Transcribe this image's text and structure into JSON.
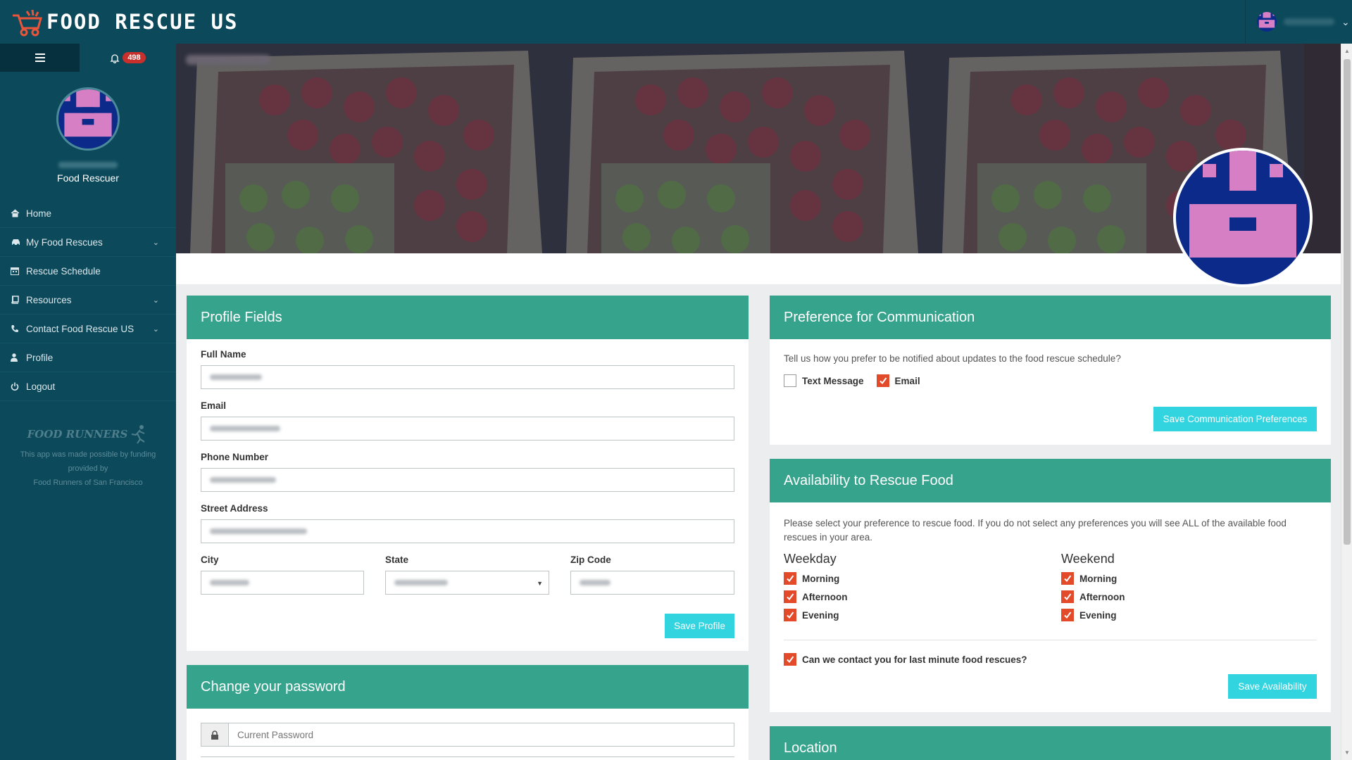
{
  "app": {
    "brand": "FOOD RESCUE US"
  },
  "sidebar": {
    "notification_count": "498",
    "role": "Food Rescuer",
    "items": [
      {
        "label": "Home",
        "icon": "home-icon"
      },
      {
        "label": "My Food Rescues",
        "icon": "car-icon"
      },
      {
        "label": "Rescue Schedule",
        "icon": "calendar-icon"
      },
      {
        "label": "Resources",
        "icon": "book-icon"
      },
      {
        "label": "Contact Food Rescue US",
        "icon": "phone-icon"
      },
      {
        "label": "Profile",
        "icon": "user-icon"
      },
      {
        "label": "Logout",
        "icon": "power-icon"
      }
    ],
    "funding_logo": "FOOD RUNNERS",
    "funding_line1": "This app was made possible by funding",
    "funding_line2": "provided by",
    "funding_line3": "Food Runners of San Francisco"
  },
  "profile": {
    "title": "Profile Fields",
    "full_name_label": "Full Name",
    "email_label": "Email",
    "phone_label": "Phone Number",
    "street_label": "Street Address",
    "city_label": "City",
    "state_label": "State",
    "zip_label": "Zip Code",
    "save_label": "Save Profile"
  },
  "password": {
    "title": "Change your password",
    "current_placeholder": "Current Password"
  },
  "communication": {
    "title": "Preference for Communication",
    "question": "Tell us how you prefer to be notified about updates to the food rescue schedule?",
    "text_label": "Text Message",
    "email_label": "Email",
    "save_label": "Save Communication Preferences"
  },
  "availability": {
    "title": "Availability to Rescue Food",
    "description": "Please select your preference to rescue food. If you do not select any preferences you will see ALL of the available food rescues in your area.",
    "weekday_title": "Weekday",
    "weekend_title": "Weekend",
    "morning": "Morning",
    "afternoon": "Afternoon",
    "evening": "Evening",
    "last_minute": "Can we contact you for last minute food rescues?",
    "save_label": "Save Availability"
  },
  "location": {
    "title": "Location"
  },
  "colors": {
    "brand": "#0c4a5b",
    "panel_header": "#36a38c",
    "button": "#32d4e0",
    "checkbox": "#e24a2a"
  }
}
